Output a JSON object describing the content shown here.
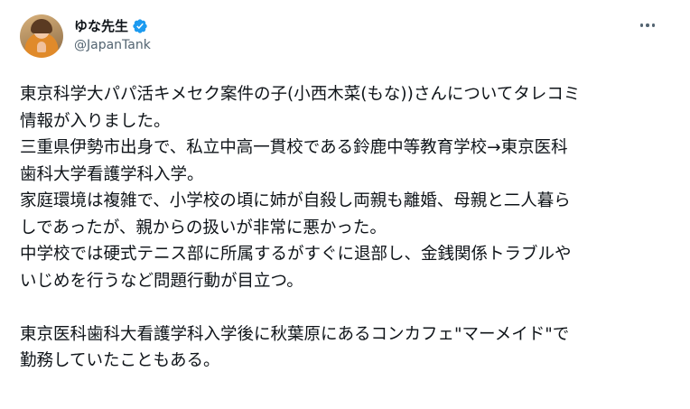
{
  "author": {
    "display_name": "ゆな先生",
    "handle": "@JapanTank",
    "verified": true,
    "verified_color": "#1d9bf0",
    "avatar_icon": "avatar-photo"
  },
  "menu": {
    "icon": "more-horizontal-icon"
  },
  "tweet": {
    "lines": [
      "東京科学大パパ活キメセク案件の子(小西木菜(もな))さんについてタレコミ",
      "情報が入りました。",
      "三重県伊勢市出身で、私立中高一貫校である鈴鹿中等教育学校→東京医科",
      "歯科大学看護学科入学。",
      "家庭環境は複雑で、小学校の頃に姉が自殺し両親も離婚、母親と二人暮ら",
      "しであったが、親からの扱いが非常に悪かった。",
      "中学校では硬式テニス部に所属するがすぐに退部し、金銭関係トラブルや",
      "いじめを行うなど問題行動が目立つ。",
      "",
      "東京医科歯科大看護学科入学後に秋葉原にあるコンカフェ\"マーメイド\"で",
      "勤務していたこともある。"
    ]
  }
}
